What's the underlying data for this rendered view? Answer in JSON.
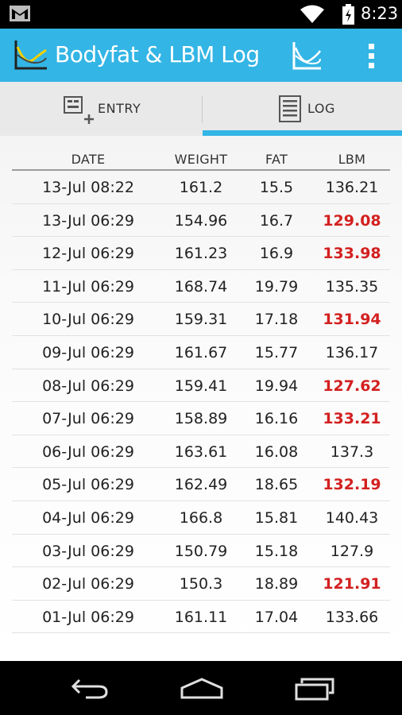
{
  "status_bar": {
    "time": "8:23",
    "icons": [
      "gmail-icon",
      "wifi-icon",
      "battery-icon"
    ]
  },
  "action_bar": {
    "title": "Bodyfat & LBM Log",
    "accent_color": "#33b5e5",
    "actions": [
      "graph-icon",
      "overflow-menu-icon"
    ]
  },
  "tabs": [
    {
      "label": "ENTRY",
      "icon": "entry-icon",
      "selected": false
    },
    {
      "label": "LOG",
      "icon": "log-icon",
      "selected": true
    }
  ],
  "log_table": {
    "headers": {
      "date": "DATE",
      "weight": "WEIGHT",
      "fat": "FAT",
      "lbm": "LBM"
    },
    "highlight_color": "#d32020",
    "rows": [
      {
        "date": "13-Jul 08:22",
        "weight": "161.2",
        "fat": "15.5",
        "lbm": "136.21",
        "lbm_down": false
      },
      {
        "date": "13-Jul 06:29",
        "weight": "154.96",
        "fat": "16.7",
        "lbm": "129.08",
        "lbm_down": true
      },
      {
        "date": "12-Jul 06:29",
        "weight": "161.23",
        "fat": "16.9",
        "lbm": "133.98",
        "lbm_down": true
      },
      {
        "date": "11-Jul 06:29",
        "weight": "168.74",
        "fat": "19.79",
        "lbm": "135.35",
        "lbm_down": false
      },
      {
        "date": "10-Jul 06:29",
        "weight": "159.31",
        "fat": "17.18",
        "lbm": "131.94",
        "lbm_down": true
      },
      {
        "date": "09-Jul 06:29",
        "weight": "161.67",
        "fat": "15.77",
        "lbm": "136.17",
        "lbm_down": false
      },
      {
        "date": "08-Jul 06:29",
        "weight": "159.41",
        "fat": "19.94",
        "lbm": "127.62",
        "lbm_down": true
      },
      {
        "date": "07-Jul 06:29",
        "weight": "158.89",
        "fat": "16.16",
        "lbm": "133.21",
        "lbm_down": true
      },
      {
        "date": "06-Jul 06:29",
        "weight": "163.61",
        "fat": "16.08",
        "lbm": "137.3",
        "lbm_down": false
      },
      {
        "date": "05-Jul 06:29",
        "weight": "162.49",
        "fat": "18.65",
        "lbm": "132.19",
        "lbm_down": true
      },
      {
        "date": "04-Jul 06:29",
        "weight": "166.8",
        "fat": "15.81",
        "lbm": "140.43",
        "lbm_down": false
      },
      {
        "date": "03-Jul 06:29",
        "weight": "150.79",
        "fat": "15.18",
        "lbm": "127.9",
        "lbm_down": false
      },
      {
        "date": "02-Jul 06:29",
        "weight": "150.3",
        "fat": "18.89",
        "lbm": "121.91",
        "lbm_down": true
      },
      {
        "date": "01-Jul 06:29",
        "weight": "161.11",
        "fat": "17.04",
        "lbm": "133.66",
        "lbm_down": false
      }
    ]
  },
  "nav_bar": {
    "buttons": [
      "back-icon",
      "home-icon",
      "recent-apps-icon"
    ]
  }
}
